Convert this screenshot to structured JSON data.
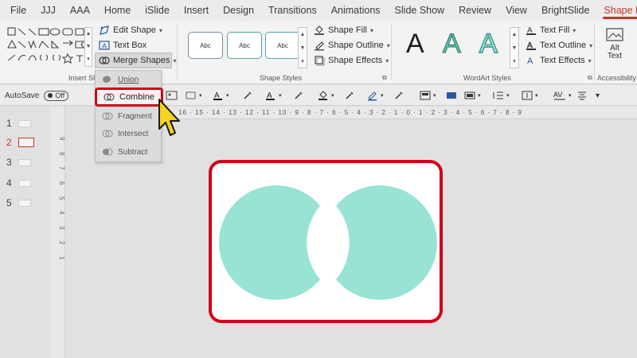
{
  "tabs": [
    "File",
    "JJJ",
    "AAA",
    "Home",
    "iSlide",
    "Insert",
    "Design",
    "Transitions",
    "Animations",
    "Slide Show",
    "Review",
    "View",
    "BrightSlide",
    "Shape Format"
  ],
  "active_tab": "Shape Format",
  "ribbon": {
    "insert_shapes": {
      "edit_shape": "Edit Shape",
      "text_box": "Text Box",
      "merge_shapes": "Merge Shapes",
      "label": "Insert Sh"
    },
    "shape_styles": {
      "preset_label": "Abc",
      "shape_fill": "Shape Fill",
      "shape_outline": "Shape Outline",
      "shape_effects": "Shape Effects",
      "label": "Shape Styles"
    },
    "wordart": {
      "letter": "A",
      "text_fill": "Text Fill",
      "text_outline": "Text Outline",
      "text_effects": "Text Effects",
      "label": "WordArt Styles"
    },
    "accessibility": {
      "alt_text_line1": "Alt",
      "alt_text_line2": "Text",
      "label": "Accessibility"
    }
  },
  "qat": {
    "autosave_label": "AutoSave",
    "autosave_state": "Off"
  },
  "merge_menu": {
    "items": [
      "Union",
      "Combine",
      "Fragment",
      "Intersect",
      "Subtract"
    ],
    "highlighted": "Combine"
  },
  "slides": [
    "1",
    "2",
    "3",
    "4",
    "5"
  ],
  "selected_slide": "2",
  "ruler": {
    "horizontal": "16 · 15 · 14 · 13 · 12 · 11 · 10 · 9 · 8 · 7 · 6 · 5 · 4 · 3 · 2 · 1 · 0 · 1 · 2 · 3 · 4 · 5 · 6 · 7 · 8 · 9",
    "vertical": [
      "9",
      "8",
      "7",
      "6",
      "5",
      "4",
      "3",
      "2",
      "1"
    ]
  },
  "colors": {
    "accent_red": "#c0392b",
    "highlight_red": "#d0021b",
    "shape_fill": "#99e3d5",
    "cursor_yellow": "#f7d31c"
  },
  "icons": {
    "cursor": "pointer-hand-icon",
    "merge": "merge-shapes-icon"
  }
}
